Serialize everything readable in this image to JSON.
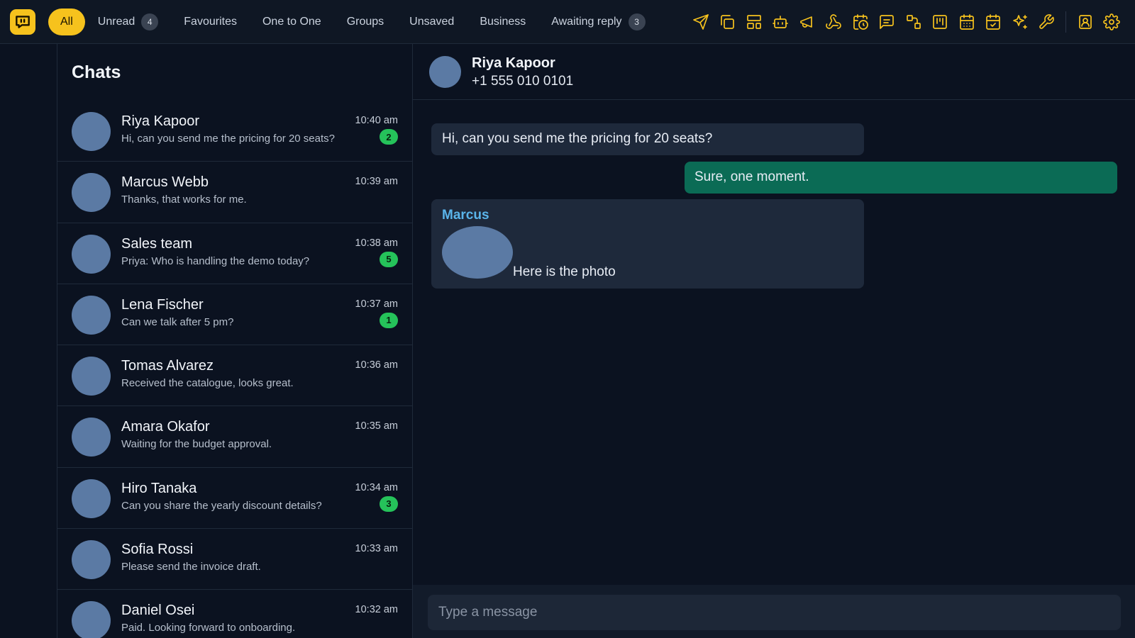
{
  "filters": [
    {
      "label": "All",
      "active": true
    },
    {
      "label": "Unread",
      "count": "4"
    },
    {
      "label": "Favourites"
    },
    {
      "label": "One to One"
    },
    {
      "label": "Groups"
    },
    {
      "label": "Unsaved"
    },
    {
      "label": "Business"
    },
    {
      "label": "Awaiting reply",
      "count": "3"
    }
  ],
  "toolbar_icons": [
    "send-icon",
    "copy-icon",
    "layout-icon",
    "bot-icon",
    "megaphone-icon",
    "webhook-icon",
    "calendar-clock-icon",
    "message-square-icon",
    "route-icon",
    "kanban-icon",
    "calendar-icon",
    "calendar-check-icon",
    "sparkles-icon",
    "wrench-icon",
    "contact-icon",
    "settings-icon"
  ],
  "accent_color": "#f6c21d",
  "chats": {
    "title": "Chats",
    "items": [
      {
        "name": "Riya Kapoor",
        "preview": "Hi, can you send me the pricing for 20 seats?",
        "time": "10:40 am",
        "unread": "2"
      },
      {
        "name": "Marcus Webb",
        "preview": "Thanks, that works for me.",
        "time": "10:39 am"
      },
      {
        "name": "Sales team",
        "preview": "Priya: Who is handling the demo today?",
        "time": "10:38 am",
        "unread": "5"
      },
      {
        "name": "Lena Fischer",
        "preview": "Can we talk after 5 pm?",
        "time": "10:37 am",
        "unread": "1"
      },
      {
        "name": "Tomas Alvarez",
        "preview": "Received the catalogue, looks great.",
        "time": "10:36 am"
      },
      {
        "name": "Amara Okafor",
        "preview": "Waiting for the budget approval.",
        "time": "10:35 am"
      },
      {
        "name": "Hiro Tanaka",
        "preview": "Can you share the yearly discount details?",
        "time": "10:34 am",
        "unread": "3"
      },
      {
        "name": "Sofia Rossi",
        "preview": "Please send the invoice draft.",
        "time": "10:33 am"
      },
      {
        "name": "Daniel Osei",
        "preview": "Paid. Looking forward to onboarding.",
        "time": "10:32 am"
      }
    ]
  },
  "conversation": {
    "name": "Riya Kapoor",
    "phone": "+1 555 010 0101",
    "messages": [
      {
        "text": "Hi, can you send me the pricing for 20 seats?"
      },
      {
        "text": "Sure, one moment."
      },
      {
        "sender": "Marcus",
        "caption": "Here is the photo"
      }
    ],
    "composer_placeholder": "Type a message"
  }
}
